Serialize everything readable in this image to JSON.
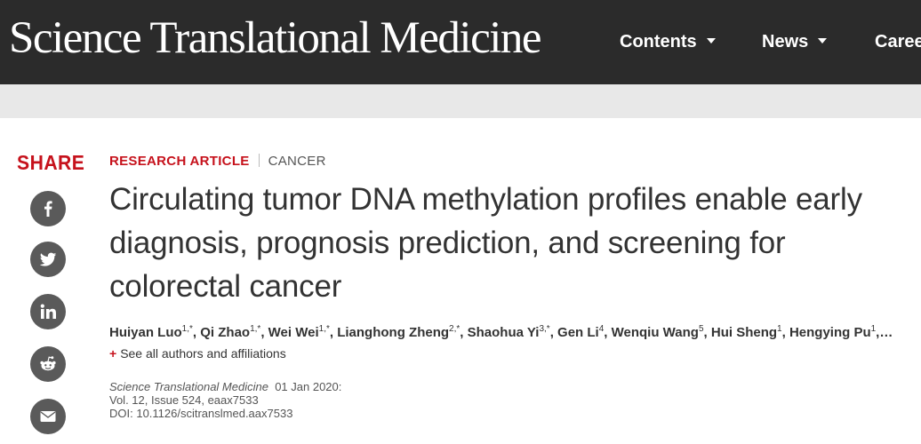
{
  "header": {
    "brand": "Science Translational Medicine",
    "nav": [
      {
        "label": "Contents"
      },
      {
        "label": "News"
      },
      {
        "label": "Careers"
      }
    ]
  },
  "share": {
    "label": "SHARE",
    "buttons": [
      "facebook-icon",
      "twitter-icon",
      "linkedin-icon",
      "reddit-icon",
      "email-icon"
    ]
  },
  "article": {
    "type": "RESEARCH ARTICLE",
    "subject": "CANCER",
    "title": "Circulating tumor DNA methylation profiles enable early diagnosis, prognosis prediction, and screening for colorectal cancer",
    "authors": [
      {
        "name": "Huiyan Luo",
        "sup": "1,*"
      },
      {
        "name": "Qi Zhao",
        "sup": "1,*"
      },
      {
        "name": "Wei Wei",
        "sup": "1,*"
      },
      {
        "name": "Lianghong Zheng",
        "sup": "2,*"
      },
      {
        "name": "Shaohua Yi",
        "sup": "3,*"
      },
      {
        "name": "Gen Li",
        "sup": "4"
      },
      {
        "name": "Wenqiu Wang",
        "sup": "5"
      },
      {
        "name": "Hui Sheng",
        "sup": "1"
      },
      {
        "name": "Hengying Pu",
        "sup": "1"
      }
    ],
    "authors_more": "…",
    "see_all": "See all authors and affiliations",
    "journal": "Science Translational Medicine",
    "date": "01 Jan 2020:",
    "volume": "Vol. 12, Issue 524, eaax7533",
    "doi": "DOI: 10.1126/scitranslmed.aax7533"
  },
  "colors": {
    "accent": "#c6121c",
    "header_bg": "#2b2b2b",
    "share_btn": "#5a5a5a"
  }
}
